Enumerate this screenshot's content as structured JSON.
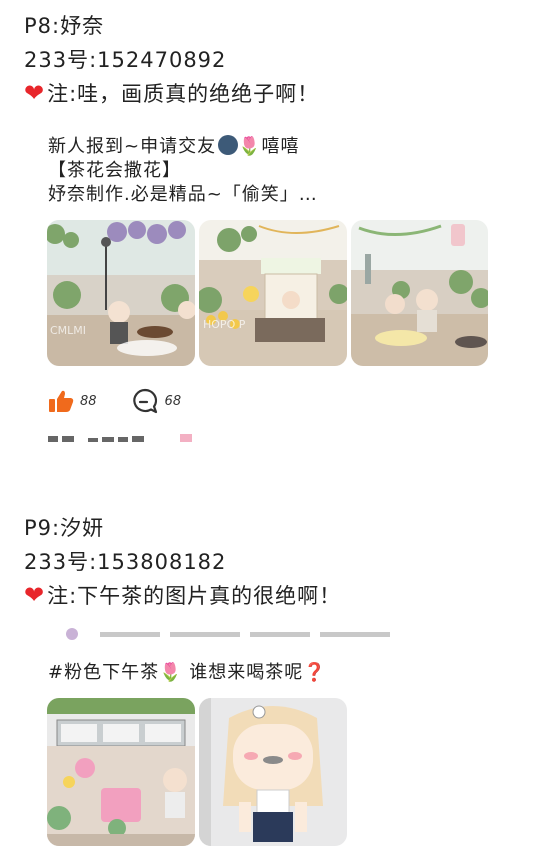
{
  "post1": {
    "title": "P8:妤奈",
    "id_line": "233号:152470892",
    "note": "注:哇，画质真的绝绝子啊！",
    "text_line1": "新人报到~申请交友",
    "text_line1_suffix": "嘻嘻",
    "text_line2": "【茶花会撒花】",
    "text_line3": "妤奈制作.必是精品~「偷笑」…",
    "likes": "88",
    "comments": "68"
  },
  "post2": {
    "title": "P9:汐妍",
    "id_line": "233号:153808182",
    "note": "注:下午茶的图片真的很绝啊！",
    "hashtag": "#粉色下午茶",
    "hashtag_suffix": "谁想来喝茶呢"
  },
  "icons": {
    "heart": "red-heart-icon",
    "like": "thumbs-up-icon",
    "comment": "comment-bubble-icon",
    "moon": "moon-emoji-icon",
    "tulip": "tulip-emoji-icon",
    "question": "red-question-icon"
  },
  "colors": {
    "heart": "#e8262b",
    "like": "#f06a1c",
    "text": "#222222"
  }
}
